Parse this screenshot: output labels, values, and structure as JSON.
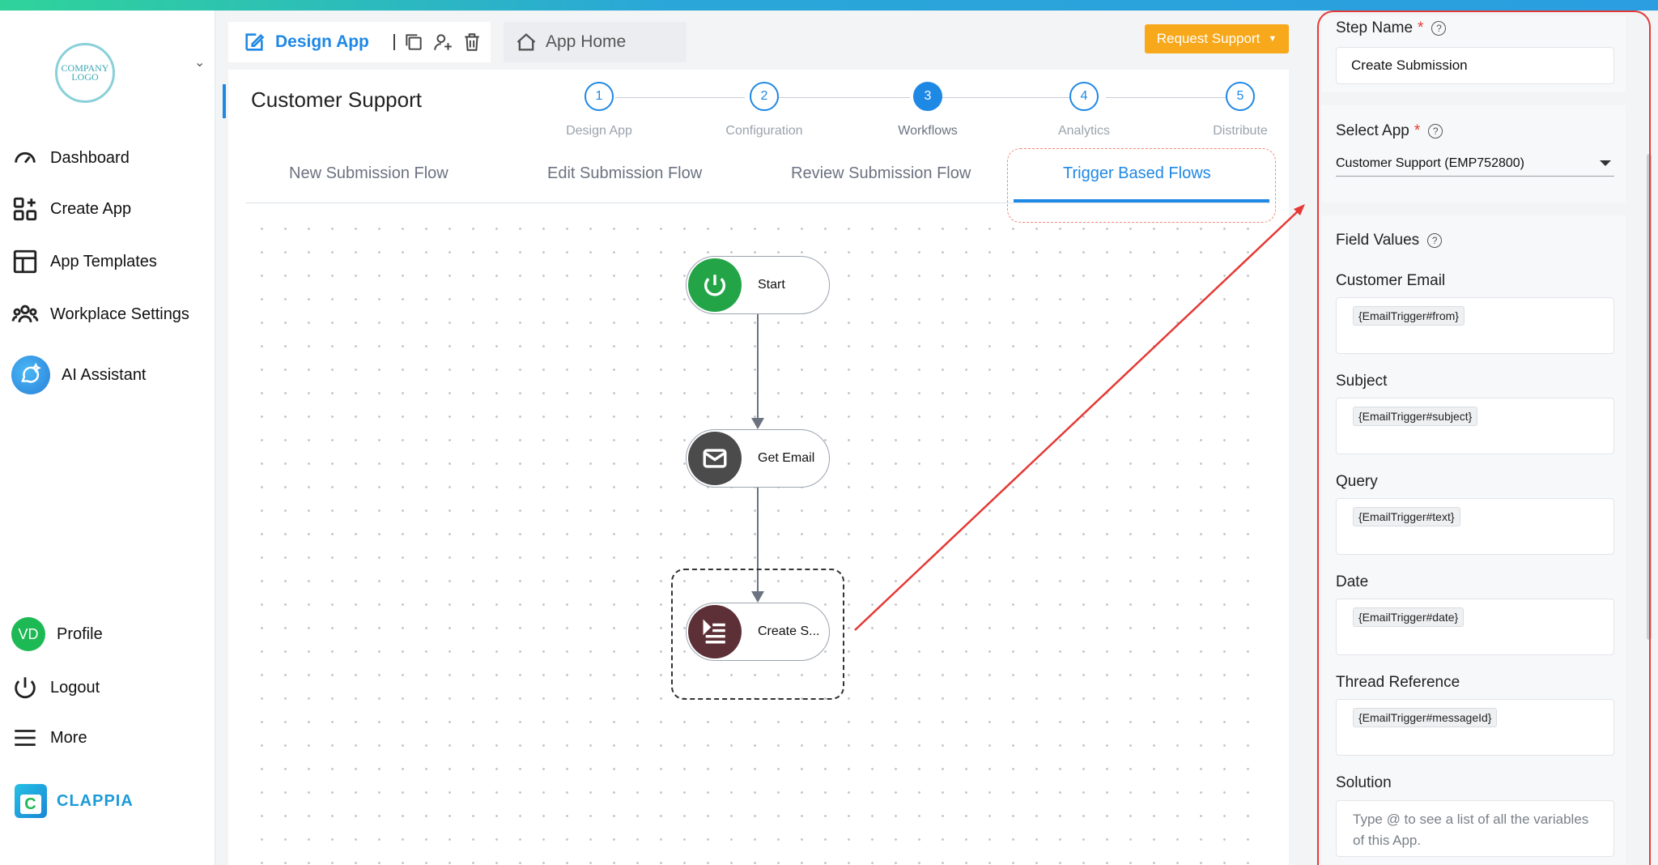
{
  "sidebar": {
    "logo_text": "COMPANY LOGO",
    "items": [
      {
        "label": "Dashboard",
        "icon": "gauge-icon"
      },
      {
        "label": "Create App",
        "icon": "grid-plus-icon"
      },
      {
        "label": "App Templates",
        "icon": "template-icon"
      },
      {
        "label": "Workplace Settings",
        "icon": "users-icon"
      },
      {
        "label": "AI Assistant",
        "icon": "ai-assistant-icon"
      }
    ],
    "profile": {
      "initials": "VD",
      "label": "Profile",
      "color": "#1db954"
    },
    "logout_label": "Logout",
    "more_label": "More",
    "brand": {
      "mark": "C",
      "name": "CLAPPIA"
    }
  },
  "header": {
    "design_app_label": "Design App",
    "app_home_label": "App Home",
    "request_support_label": "Request Support"
  },
  "page": {
    "title": "Customer Support"
  },
  "steps": [
    {
      "num": "1",
      "label": "Design App"
    },
    {
      "num": "2",
      "label": "Configuration"
    },
    {
      "num": "3",
      "label": "Workflows"
    },
    {
      "num": "4",
      "label": "Analytics"
    },
    {
      "num": "5",
      "label": "Distribute"
    }
  ],
  "tabs": [
    {
      "label": "New Submission Flow"
    },
    {
      "label": "Edit Submission Flow"
    },
    {
      "label": "Review Submission Flow"
    },
    {
      "label": "Trigger Based Flows"
    }
  ],
  "workflow": {
    "nodes": [
      {
        "label": "Start",
        "icon": "power-icon",
        "color": "#22a447"
      },
      {
        "label": "Get Email",
        "icon": "mail-icon",
        "color": "#4b4b4b"
      },
      {
        "label": "Create S...",
        "icon": "list-icon",
        "color": "#5c3036"
      }
    ]
  },
  "panel": {
    "step_name": {
      "label": "Step Name",
      "required": "*",
      "help": "?",
      "value": "Create Submission"
    },
    "select_app": {
      "label": "Select App",
      "required": "*",
      "help": "?",
      "value": "Customer Support (EMP752800)"
    },
    "field_values": {
      "label": "Field Values",
      "help": "?",
      "fields": [
        {
          "label": "Customer Email",
          "value": "{EmailTrigger#from}"
        },
        {
          "label": "Subject",
          "value": "{EmailTrigger#subject}"
        },
        {
          "label": "Query",
          "value": "{EmailTrigger#text}"
        },
        {
          "label": "Date",
          "value": "{EmailTrigger#date}"
        },
        {
          "label": "Thread Reference",
          "value": "{EmailTrigger#messageId}"
        }
      ],
      "solution": {
        "label": "Solution",
        "placeholder": "Type @ to see a list of all the variables of this App."
      }
    }
  },
  "colors": {
    "accent": "#1e88e5",
    "warning": "#f7a81b",
    "annotation": "#e53935"
  }
}
